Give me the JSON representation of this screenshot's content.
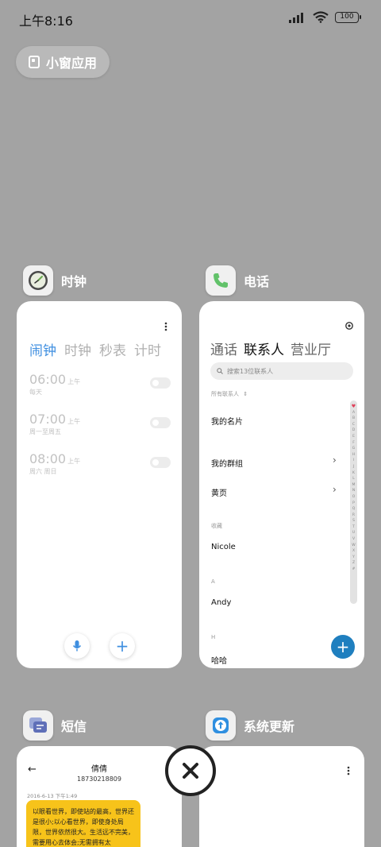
{
  "status": {
    "time": "上午8:16",
    "battery": "100"
  },
  "float_pill": {
    "label": "小窗应用"
  },
  "clock": {
    "app_name": "时钟",
    "tabs": [
      "闹钟",
      "时钟",
      "秒表",
      "计时"
    ],
    "alarms": [
      {
        "time": "06:00",
        "ampm": "上午",
        "days": "每天"
      },
      {
        "time": "07:00",
        "ampm": "上午",
        "days": "周一至周五"
      },
      {
        "time": "08:00",
        "ampm": "上午",
        "days": "周六 周日"
      }
    ],
    "add_symbol": "+"
  },
  "phone": {
    "app_name": "电话",
    "tabs": [
      "通话",
      "联系人",
      "营业厅"
    ],
    "search_placeholder": "搜索13位联系人",
    "all_contacts": "所有联系人",
    "my_card": "我的名片",
    "my_groups": "我的群组",
    "yellow_pages": "黄页",
    "favorites_label": "收藏",
    "favorite_contact": "Nicole",
    "section_a": "A",
    "contact_a": "Andy",
    "section_h": "H",
    "contact_h": "哈哈",
    "index_letters": [
      "♥",
      "A",
      "B",
      "C",
      "D",
      "E",
      "F",
      "G",
      "H",
      "I",
      "J",
      "K",
      "L",
      "M",
      "N",
      "O",
      "P",
      "Q",
      "R",
      "S",
      "T",
      "U",
      "V",
      "W",
      "X",
      "Y",
      "Z",
      "#"
    ],
    "fab_symbol": "+"
  },
  "sms": {
    "app_name": "短信",
    "contact_name": "倩倩",
    "contact_number": "18730218809",
    "date": "2016-6-13 下午1:49",
    "message": "以眼看世界，即使站的最高，世界还是很小;以心看世界，即使身处局限，世界依然很大。生活远不完美，需要用心去体会;无需拥有太"
  },
  "update": {
    "app_name": "系统更新"
  },
  "colors": {
    "accent_blue": "#3f8fe0",
    "fab_blue": "#1f7fbf",
    "bubble_yellow": "#f7c31a"
  }
}
